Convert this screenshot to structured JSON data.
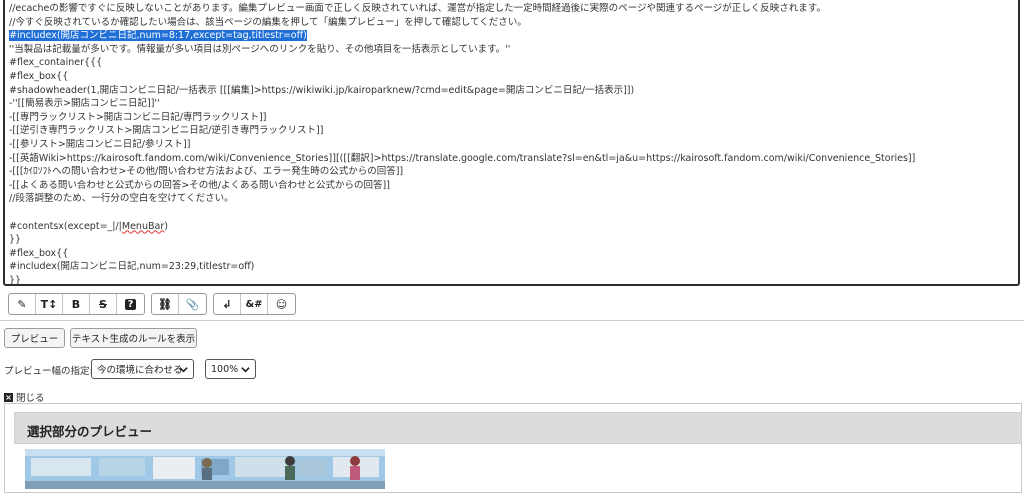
{
  "editor": {
    "lines": [
      "//ecacheの影響ですぐに反映しないことがあります。編集プレビュー画面で正しく反映されていれば、運営が指定した一定時間経過後に実際のページや関連するページが正しく反映されます。",
      "//今すぐ反映されているか確認したい場合は、該当ページの編集を押して「編集プレビュー」を押して確認してください。",
      "#includex(開店コンビニ日記,num=8:17,except=tag,titlestr=off)",
      "''当製品は記載量が多いです。情報量が多い項目は別ページへのリンクを貼り、その他項目を一括表示としています。''",
      "#flex_container{{{",
      "#flex_box{{",
      "#shadowheader(1,開店コンビニ日記/一括表示 [[[編集]>https://wikiwiki.jp/kairoparknew/?cmd=edit&page=開店コンビニ日記/一括表示]])",
      "-''[[簡易表示>開店コンビニ日記]]''",
      "-[[専門ラックリスト>開店コンビニ日記/専門ラックリスト]]",
      "-[[逆引き専門ラックリスト>開店コンビニ日記/逆引き専門ラックリスト]]",
      "-[[参リスト>開店コンビニ日記/参リスト]]",
      "-[[英語Wiki>https://kairosoft.fandom.com/wiki/Convenience_Stories]][([[翻訳]>https://translate.google.com/translate?sl=en&tl=ja&u=https://kairosoft.fandom.com/wiki/Convenience_Stories]]",
      "-[[[ｶｲﾛｿﾌﾄへの問い合わせ>その他/問い合わせ方法および、エラー発生時の公式からの回答]]",
      "-[[よくある問い合わせと公式からの回答>その他/よくある問い合わせと公式からの回答]]",
      "//段落調整のため、一行分の空白を空けてください。",
      "",
      "#contentsx(except=_|/|MenuBar)",
      "}}",
      "#flex_box{{",
      "#includex(開店コンビニ日記,num=23:29,titlestr=off)",
      "}}"
    ]
  },
  "toolbar": {
    "groups": [
      [
        {
          "name": "pencil-icon",
          "glyph": "✎"
        },
        {
          "name": "font-size-icon",
          "glyph": "T↕"
        },
        {
          "name": "bold-icon",
          "glyph": "B"
        },
        {
          "name": "strikethrough-icon",
          "glyph": "S"
        },
        {
          "name": "help-icon",
          "glyph": "?"
        }
      ],
      [
        {
          "name": "link-icon",
          "glyph": "⛓"
        },
        {
          "name": "attach-icon",
          "glyph": "📎"
        }
      ],
      [
        {
          "name": "newline-icon",
          "glyph": "↲"
        },
        {
          "name": "special-char-icon",
          "glyph": "&#"
        },
        {
          "name": "emoji-icon",
          "glyph": "☺"
        }
      ]
    ]
  },
  "buttons": {
    "preview": "プレビュー",
    "rules": "テキスト生成のルールを表示"
  },
  "preview_width": {
    "label": "プレビュー幅の指定:",
    "device_value": "今の環境に合わせる",
    "zoom_value": "100%"
  },
  "close_label": "閉じる",
  "panel_title": "選択部分のプレビュー",
  "colors": {
    "selection": "#1f6fd6",
    "panel_header": "#dcdcdc"
  }
}
